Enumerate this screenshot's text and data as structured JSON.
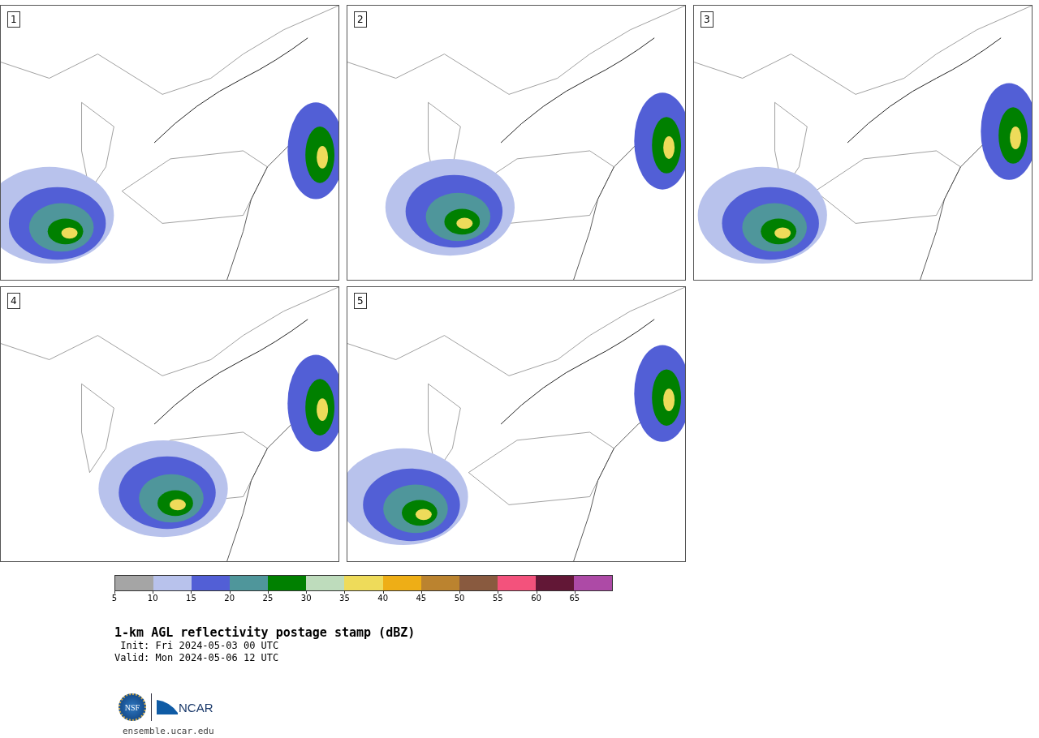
{
  "panels": [
    {
      "label": "1"
    },
    {
      "label": "2"
    },
    {
      "label": "3"
    },
    {
      "label": "4"
    },
    {
      "label": "5"
    }
  ],
  "colorbar": {
    "bins": [
      {
        "label": "5",
        "color": "#a5a5a5"
      },
      {
        "label": "10",
        "color": "#b8c2ec"
      },
      {
        "label": "15",
        "color": "#525fd6"
      },
      {
        "label": "20",
        "color": "#4f969b"
      },
      {
        "label": "25",
        "color": "#008000"
      },
      {
        "label": "30",
        "color": "#bedcbc"
      },
      {
        "label": "35",
        "color": "#eedb5a"
      },
      {
        "label": "40",
        "color": "#eeae16"
      },
      {
        "label": "45",
        "color": "#bb832f"
      },
      {
        "label": "50",
        "color": "#895a3f"
      },
      {
        "label": "55",
        "color": "#f3527c"
      },
      {
        "label": "60",
        "color": "#621736"
      },
      {
        "label": "65",
        "color": "#ad4aa6"
      }
    ]
  },
  "title": "1-km AGL reflectivity postage stamp (dBZ)",
  "init": " Init: Fri 2024-05-03 00 UTC",
  "valid": "Valid: Mon 2024-05-06 12 UTC",
  "logos": {
    "nsf": "NSF",
    "ncar": "NCAR"
  },
  "url": "ensemble.ucar.edu"
}
